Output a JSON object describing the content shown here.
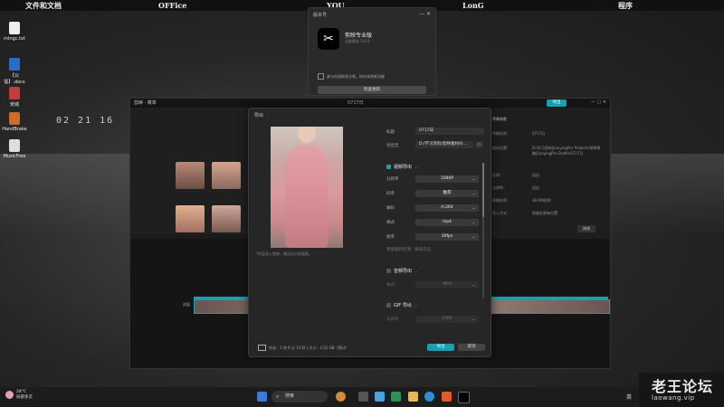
{
  "desktop": {
    "top_labels": [
      "文件和文档",
      "OFFice",
      "YOU",
      "LonG",
      "程序"
    ],
    "icons": [
      {
        "label": "mingc.txt",
        "icon": "text-file-icon"
      },
      {
        "label": "【公需】.docx",
        "icon": "word-doc-icon"
      },
      {
        "label": "荧城",
        "icon": "app-icon"
      },
      {
        "label": "HandBrake",
        "icon": "handbrake-icon"
      },
      {
        "label": "MusicFree",
        "icon": "music-icon"
      }
    ],
    "clock": "02 21 16"
  },
  "update_popup": {
    "title": "版本号",
    "app_name": "剪映专业版",
    "version": "当前版本 5.0.1",
    "checkbox_label": "参与内测体验计划，抢先体验新功能",
    "button": "检查更新"
  },
  "editor": {
    "brand": "剪映",
    "menu": "菜单",
    "project_title": "0717日",
    "export_button": "导出",
    "right_panel": {
      "header": "草稿参数",
      "rows": [
        {
          "label": "草稿名称：",
          "value": "0717日"
        },
        {
          "label": "保存位置：",
          "value": "D:/学习资料/JianyingPro Projects/剪映草稿/JianyingPro Drafts/0717日"
        },
        {
          "label": "比例：",
          "value": "适应"
        },
        {
          "label": "分辨率：",
          "value": "适应"
        },
        {
          "label": "草稿帧率：",
          "value": "30.00帧/秒"
        },
        {
          "label": "导入方式：",
          "value": "保留在原有位置"
        }
      ],
      "edit_button": "修改"
    },
    "track_label": "封面"
  },
  "export_dialog": {
    "title": "导出",
    "cover_note": "*作品导入剪映，建议比对封面图。",
    "fields": [
      {
        "label": "标题",
        "value": "0717日"
      },
      {
        "label": "导出至",
        "value": "D:/学习资料/剪映素材/0..."
      }
    ],
    "video_section": "视频导出",
    "video_fields": [
      {
        "label": "分辨率",
        "value": "1080P"
      },
      {
        "label": "码率",
        "value": "推荐"
      },
      {
        "label": "编码",
        "value": "H.264"
      },
      {
        "label": "格式",
        "value": "mp4"
      },
      {
        "label": "帧率",
        "value": "30fps"
      }
    ],
    "copyright": "智能版权检测 · 暂未开启",
    "audio_section": "音频导出",
    "audio_fields": [
      {
        "label": "格式",
        "value": "MP3"
      }
    ],
    "gif_section": "GIF 导出",
    "gif_fields": [
      {
        "label": "分辨率",
        "value": "240P"
      }
    ],
    "footer_info": "时长：1 时 8 分 13 秒 | 大小：3.51 GB（预计）",
    "export_button": "导出",
    "cancel_button": "取消"
  },
  "taskbar": {
    "weather_temp": "28°C",
    "weather_desc": "局部多云",
    "search_placeholder": "搜索",
    "tray_lang": "英"
  },
  "watermark": {
    "line1": "老王论坛",
    "line2": "laowang.vip"
  },
  "colors": {
    "accent": "#1a9fb0"
  }
}
